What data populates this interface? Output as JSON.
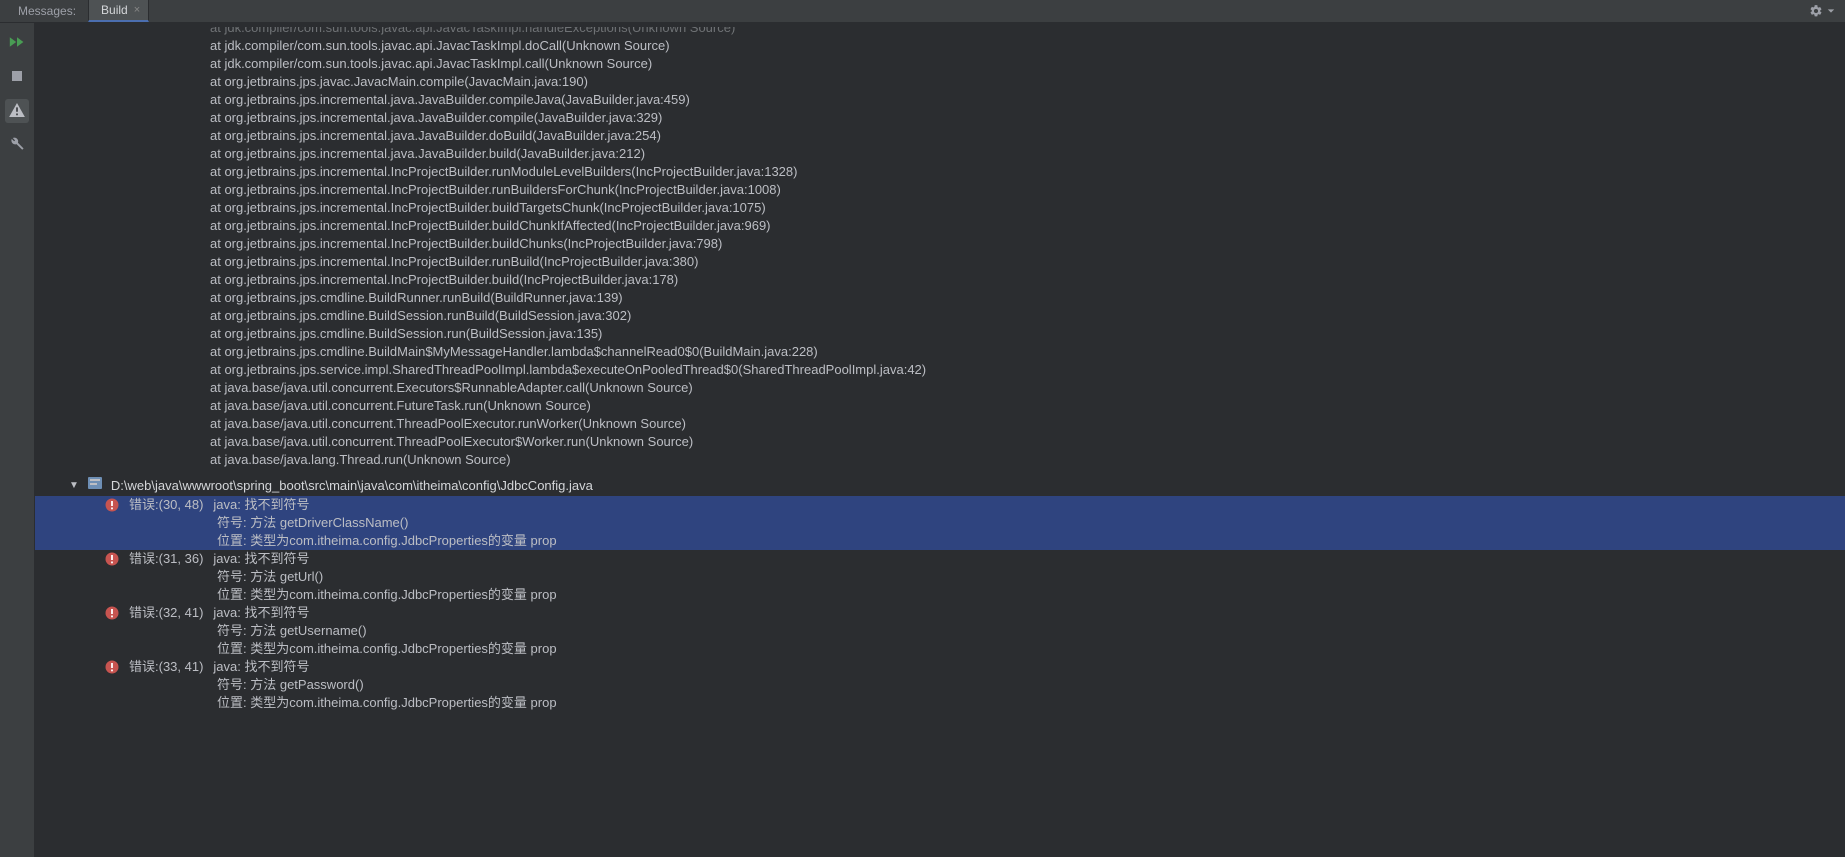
{
  "header": {
    "messages_label": "Messages:",
    "tab_label": "Build",
    "close_glyph": "×"
  },
  "stack_trace": [
    "at jdk.compiler/com.sun.tools.javac.api.JavacTaskImpl.handleExceptions(Unknown Source)",
    "at jdk.compiler/com.sun.tools.javac.api.JavacTaskImpl.doCall(Unknown Source)",
    "at jdk.compiler/com.sun.tools.javac.api.JavacTaskImpl.call(Unknown Source)",
    "at org.jetbrains.jps.javac.JavacMain.compile(JavacMain.java:190)",
    "at org.jetbrains.jps.incremental.java.JavaBuilder.compileJava(JavaBuilder.java:459)",
    "at org.jetbrains.jps.incremental.java.JavaBuilder.compile(JavaBuilder.java:329)",
    "at org.jetbrains.jps.incremental.java.JavaBuilder.doBuild(JavaBuilder.java:254)",
    "at org.jetbrains.jps.incremental.java.JavaBuilder.build(JavaBuilder.java:212)",
    "at org.jetbrains.jps.incremental.IncProjectBuilder.runModuleLevelBuilders(IncProjectBuilder.java:1328)",
    "at org.jetbrains.jps.incremental.IncProjectBuilder.runBuildersForChunk(IncProjectBuilder.java:1008)",
    "at org.jetbrains.jps.incremental.IncProjectBuilder.buildTargetsChunk(IncProjectBuilder.java:1075)",
    "at org.jetbrains.jps.incremental.IncProjectBuilder.buildChunkIfAffected(IncProjectBuilder.java:969)",
    "at org.jetbrains.jps.incremental.IncProjectBuilder.buildChunks(IncProjectBuilder.java:798)",
    "at org.jetbrains.jps.incremental.IncProjectBuilder.runBuild(IncProjectBuilder.java:380)",
    "at org.jetbrains.jps.incremental.IncProjectBuilder.build(IncProjectBuilder.java:178)",
    "at org.jetbrains.jps.cmdline.BuildRunner.runBuild(BuildRunner.java:139)",
    "at org.jetbrains.jps.cmdline.BuildSession.runBuild(BuildSession.java:302)",
    "at org.jetbrains.jps.cmdline.BuildSession.run(BuildSession.java:135)",
    "at org.jetbrains.jps.cmdline.BuildMain$MyMessageHandler.lambda$channelRead0$0(BuildMain.java:228)",
    "at org.jetbrains.jps.service.impl.SharedThreadPoolImpl.lambda$executeOnPooledThread$0(SharedThreadPoolImpl.java:42)",
    "at java.base/java.util.concurrent.Executors$RunnableAdapter.call(Unknown Source)",
    "at java.base/java.util.concurrent.FutureTask.run(Unknown Source)",
    "at java.base/java.util.concurrent.ThreadPoolExecutor.runWorker(Unknown Source)",
    "at java.base/java.util.concurrent.ThreadPoolExecutor$Worker.run(Unknown Source)",
    "at java.base/java.lang.Thread.run(Unknown Source)"
  ],
  "file_node": {
    "triangle": "▼",
    "path": "D:\\web\\java\\wwwroot\\spring_boot\\src\\main\\java\\com\\itheima\\config\\JdbcConfig.java"
  },
  "errors": [
    {
      "loc": "错误:(30, 48)",
      "msg": "java: 找不到符号",
      "detail1": "符号:   方法 getDriverClassName()",
      "detail2": "位置: 类型为com.itheima.config.JdbcProperties的变量 prop",
      "selected": true
    },
    {
      "loc": "错误:(31, 36)",
      "msg": "java: 找不到符号",
      "detail1": "符号:   方法 getUrl()",
      "detail2": "位置: 类型为com.itheima.config.JdbcProperties的变量 prop",
      "selected": false
    },
    {
      "loc": "错误:(32, 41)",
      "msg": "java: 找不到符号",
      "detail1": "符号:   方法 getUsername()",
      "detail2": "位置: 类型为com.itheima.config.JdbcProperties的变量 prop",
      "selected": false
    },
    {
      "loc": "错误:(33, 41)",
      "msg": "java: 找不到符号",
      "detail1": "符号:   方法 getPassword()",
      "detail2": "位置: 类型为com.itheima.config.JdbcProperties的变量 prop",
      "selected": false
    }
  ]
}
